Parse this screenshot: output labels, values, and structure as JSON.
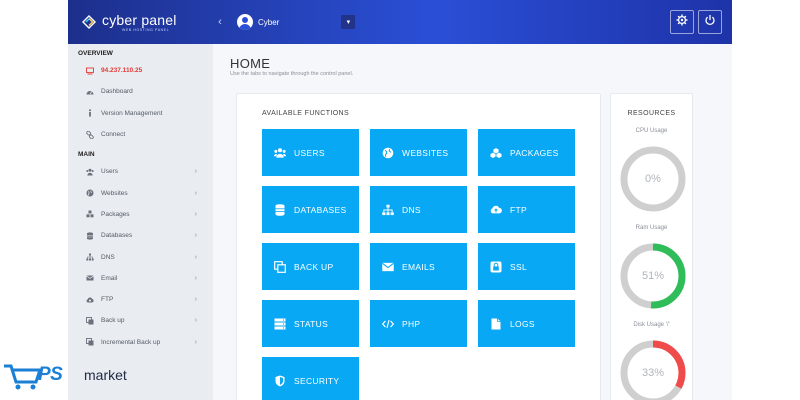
{
  "header": {
    "brand_name": "cyber panel",
    "brand_sub": "WEB HOSTING PANEL",
    "collapse_icon": "chevron-left-icon",
    "user_name": "Cyber",
    "actions": [
      "gear-icon",
      "power-icon"
    ]
  },
  "sidebar": {
    "overview_heading": "OVERVIEW",
    "overview_items": [
      {
        "label": "94.237.110.25",
        "icon": "monitor-icon"
      },
      {
        "label": "Dashboard",
        "icon": "dashboard-icon"
      },
      {
        "label": "Version Management",
        "icon": "info-icon"
      },
      {
        "label": "Connect",
        "icon": "link-icon"
      }
    ],
    "main_heading": "MAIN",
    "main_items": [
      {
        "label": "Users",
        "icon": "users-icon"
      },
      {
        "label": "Websites",
        "icon": "globe-icon"
      },
      {
        "label": "Packages",
        "icon": "cubes-icon"
      },
      {
        "label": "Databases",
        "icon": "database-icon"
      },
      {
        "label": "DNS",
        "icon": "sitemap-icon"
      },
      {
        "label": "Email",
        "icon": "envelope-icon"
      },
      {
        "label": "FTP",
        "icon": "cloud-upload-icon"
      },
      {
        "label": "Back up",
        "icon": "copy-icon"
      },
      {
        "label": "Incremental Back up",
        "icon": "copy-icon"
      }
    ]
  },
  "main": {
    "title": "HOME",
    "subtitle": "Use the tabs to navigate through the control panel.",
    "functions_title": "AVAILABLE FUNCTIONS",
    "functions": [
      {
        "label": "USERS",
        "icon": "users-icon"
      },
      {
        "label": "WEBSITES",
        "icon": "globe-icon"
      },
      {
        "label": "PACKAGES",
        "icon": "cubes-icon"
      },
      {
        "label": "DATABASES",
        "icon": "database-icon"
      },
      {
        "label": "DNS",
        "icon": "sitemap-icon"
      },
      {
        "label": "FTP",
        "icon": "cloud-upload-icon"
      },
      {
        "label": "BACK UP",
        "icon": "copy-icon"
      },
      {
        "label": "EMAILS",
        "icon": "envelope-icon"
      },
      {
        "label": "SSL",
        "icon": "lock-icon"
      },
      {
        "label": "STATUS",
        "icon": "server-icon"
      },
      {
        "label": "PHP",
        "icon": "code-icon"
      },
      {
        "label": "LOGS",
        "icon": "file-icon"
      },
      {
        "label": "SECURITY",
        "icon": "shield-icon"
      }
    ]
  },
  "resources": {
    "title": "RESOURCES",
    "items": [
      {
        "label": "CPU Usage",
        "value": "0%",
        "percent": 0
      },
      {
        "label": "Ram Usage",
        "value": "51%",
        "percent": 51
      },
      {
        "label": "Disk Usage '/'",
        "value": "33%",
        "percent": 33
      }
    ]
  },
  "colors": {
    "header_start": "#1d2f8c",
    "header_end": "#2a4fd6",
    "tile": "#09a8f5",
    "sidebar_bg": "#e9ecf1",
    "ip_text": "#e53935",
    "gauge_track": "#cfcfcf",
    "ram_arc": "#2ebd59",
    "disk_arc": "#ef4b4b"
  },
  "watermark": {
    "brand": "PS",
    "suffix": "market"
  }
}
